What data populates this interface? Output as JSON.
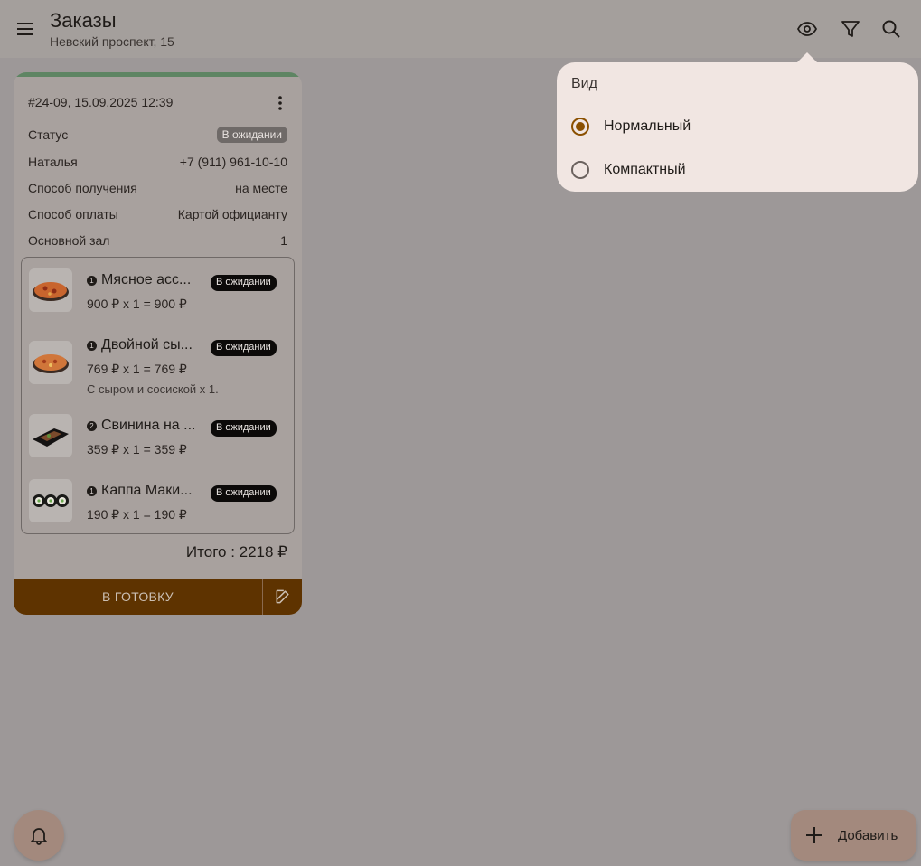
{
  "header": {
    "title": "Заказы",
    "subtitle": "Невский проспект, 15",
    "icons": [
      "menu-icon",
      "eye-icon",
      "filter-icon",
      "search-icon"
    ]
  },
  "order": {
    "header": "#24-09, 15.09.2025 12:39",
    "rows": [
      {
        "label": "Статус",
        "value": "В ожидании"
      },
      {
        "label": "Наталья",
        "value": "+7 (911) 961-10-10"
      },
      {
        "label": "Способ получения",
        "value": "на месте"
      },
      {
        "label": "Способ оплаты",
        "value": "Картой официанту"
      },
      {
        "label": "Основной зал",
        "value": "1"
      }
    ],
    "items": [
      {
        "qty": "1",
        "name": "Мясное асс...",
        "badge": "В ожидании",
        "price": "900 ₽ x 1 = 900 ₽",
        "note": ""
      },
      {
        "qty": "1",
        "name": "Двойной сы...",
        "badge": "В ожидании",
        "price": "769 ₽ x 1 = 769 ₽",
        "note": "С сыром и сосиской x 1."
      },
      {
        "qty": "2",
        "name": "Свинина на ...",
        "badge": "В ожидании",
        "price": "359 ₽ x 1 = 359 ₽",
        "note": ""
      },
      {
        "qty": "1",
        "name": "Каппа Маки...",
        "badge": "В ожидании",
        "price": "190 ₽ x 1 = 190 ₽",
        "note": ""
      }
    ],
    "total": "Итого : 2218 ₽",
    "ready_label": "В ГОТОВКУ",
    "accent_color": "#5e8563",
    "action_color": "#5e3300"
  },
  "view_popup": {
    "title": "Вид",
    "options": [
      {
        "label": "Нормальный",
        "selected": true
      },
      {
        "label": "Компактный",
        "selected": false
      }
    ]
  },
  "fab": {
    "add_label": "Добавить"
  }
}
